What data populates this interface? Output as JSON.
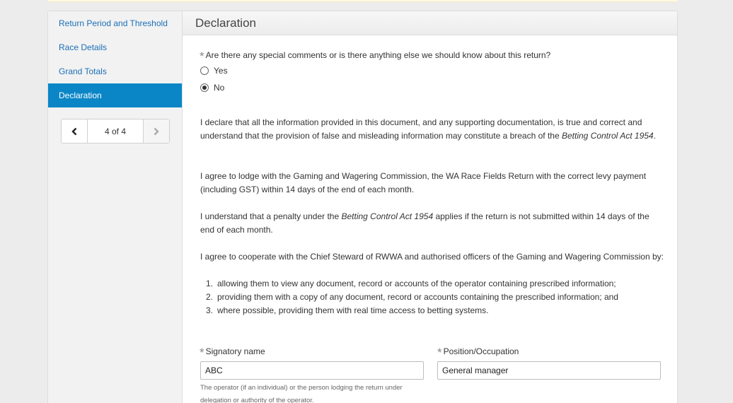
{
  "sidebar": {
    "items": [
      {
        "label": "Return Period and Threshold"
      },
      {
        "label": "Race Details"
      },
      {
        "label": "Grand Totals"
      },
      {
        "label": "Declaration"
      }
    ],
    "pager": {
      "text": "4 of 4",
      "prev_icon": "chevron-left-icon",
      "next_icon": "chevron-right-icon"
    }
  },
  "main": {
    "title": "Declaration",
    "question": "Are there any special comments or is there anything else we should know about this return?",
    "options": {
      "yes": "Yes",
      "no": "No"
    },
    "selected_option": "No",
    "para1": {
      "before": "I declare that all the information provided in this document, and any supporting documentation, is true and correct and understand that the provision of false and misleading information may constitute a breach of the ",
      "act": "Betting Control Act 1954",
      "after": "."
    },
    "para2": "I agree to lodge with the Gaming and Wagering Commission, the WA Race Fields Return with the correct levy payment (including GST) within 14 days of the end of each month.",
    "para3": {
      "before": "I understand that a penalty under the ",
      "act": "Betting Control Act 1954",
      "after": " applies if the return is not submitted within 14 days of the end of each month."
    },
    "para4": "I agree to cooperate with the Chief Steward of RWWA and authorised officers of the Gaming and Wagering Commission by:",
    "list": [
      {
        "num": "1.",
        "text": "allowing them to view any document, record or accounts of the operator containing prescribed information;"
      },
      {
        "num": "2.",
        "text": "providing them with a copy of any document, record or accounts containing the prescribed information; and"
      },
      {
        "num": "3.",
        "text": "where possible, providing them with real time access to betting systems."
      }
    ],
    "signature": {
      "label": "Signatory name",
      "value": "ABC"
    },
    "position": {
      "label": "Position/Occupation",
      "value": "General manager"
    },
    "help_text": "The operator (if an individual) or the person lodging the return under delegation or authority of the operator."
  },
  "colors": {
    "accent": "#0a86c7",
    "link": "#1c6fb7"
  }
}
